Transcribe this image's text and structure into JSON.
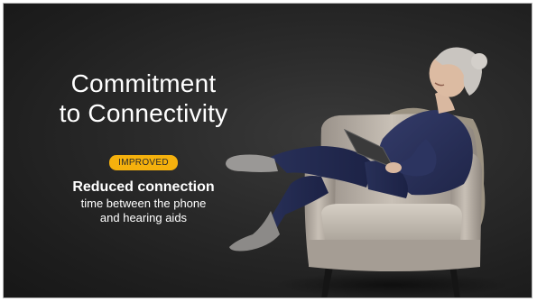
{
  "slide": {
    "headline_line1": "Commitment",
    "headline_line2": "to Connectivity",
    "badge": "IMPROVED",
    "subhead": "Reduced connection",
    "detail_line1": "time between the phone",
    "detail_line2": "and hearing aids"
  },
  "colors": {
    "background": "#262626",
    "badge": "#f5b10d",
    "text": "#ffffff"
  }
}
